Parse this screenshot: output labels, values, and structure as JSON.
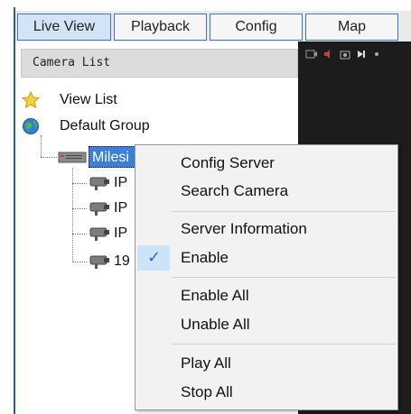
{
  "tabs": [
    {
      "label": "Live View",
      "active": true
    },
    {
      "label": "Playback",
      "active": false
    },
    {
      "label": "Config",
      "active": false
    },
    {
      "label": "Map",
      "active": false
    }
  ],
  "panel": {
    "header": "Camera List"
  },
  "tree": {
    "view_list": {
      "label": "View List",
      "icon": "star-icon"
    },
    "default_group": {
      "label": "Default Group",
      "icon": "globe-icon"
    },
    "server": {
      "label": "Milesi",
      "icon": "server-icon"
    },
    "cameras": [
      {
        "label": "IP",
        "icon": "camera-icon"
      },
      {
        "label": "IP",
        "icon": "camera-icon"
      },
      {
        "label": "IP",
        "icon": "camera-icon"
      },
      {
        "label": "19",
        "icon": "camera-icon"
      }
    ]
  },
  "context_menu": {
    "items": [
      {
        "label": "Config Server",
        "checked": false
      },
      {
        "label": "Search Camera",
        "checked": false
      },
      {
        "label": "Server Information",
        "checked": false
      },
      {
        "label": "Enable",
        "checked": true
      },
      {
        "label": "Enable All",
        "checked": false
      },
      {
        "label": "Unable All",
        "checked": false
      },
      {
        "label": "Play All",
        "checked": false
      },
      {
        "label": "Stop All",
        "checked": false
      }
    ],
    "check_glyph": "✓"
  },
  "colors": {
    "accent": "#3b7fd8",
    "frame_blue": "#1f5fb0",
    "active_tab": "#d4e4f8",
    "video_bg": "#1c1c1c",
    "menu_bg": "#f2f2f2"
  }
}
